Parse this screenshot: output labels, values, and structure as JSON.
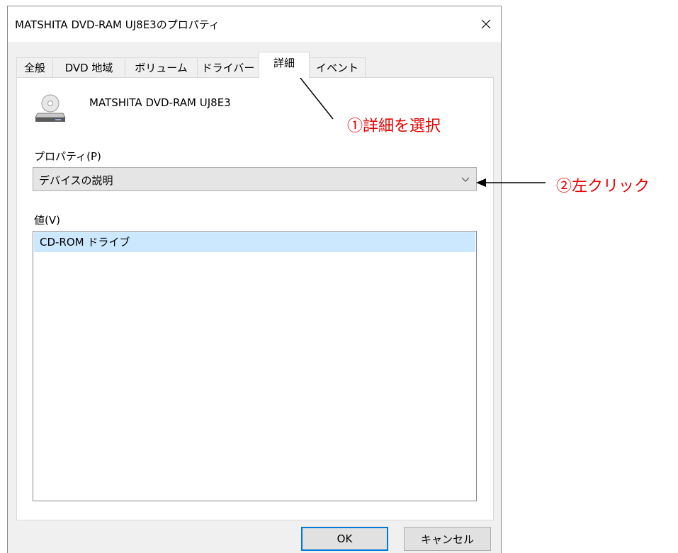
{
  "dialog": {
    "title": "MATSHITA DVD-RAM UJ8E3のプロパティ",
    "close_icon": "close-icon"
  },
  "tabs": [
    {
      "label": "全般",
      "active": false
    },
    {
      "label": "DVD 地域",
      "active": false
    },
    {
      "label": "ボリューム",
      "active": false
    },
    {
      "label": "ドライバー",
      "active": false
    },
    {
      "label": "詳細",
      "active": true
    },
    {
      "label": "イベント",
      "active": false
    }
  ],
  "details": {
    "device_icon": "dvd-drive-icon",
    "device_name": "MATSHITA DVD-RAM UJ8E3",
    "property_label": "プロパティ(P)",
    "property_selected": "デバイスの説明",
    "value_label": "値(V)",
    "values": [
      "CD-ROM ドライブ"
    ]
  },
  "buttons": {
    "ok": "OK",
    "cancel": "キャンセル"
  },
  "annotations": {
    "step1": "①詳細を選択",
    "step2": "②左クリック",
    "color": "#e60000"
  }
}
